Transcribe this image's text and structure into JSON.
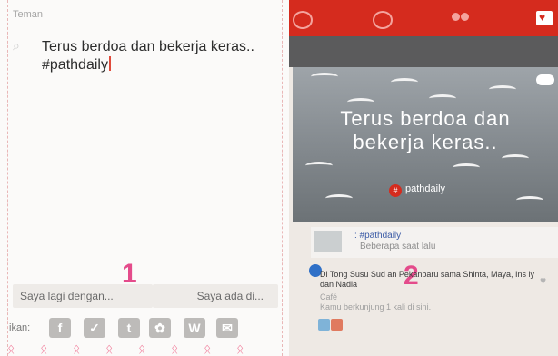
{
  "compose": {
    "section_label": "Teman",
    "text_line1": "Terus berdoa dan bekerja keras..",
    "text_line2": "#pathdaily",
    "with_placeholder": "Saya lagi dengan...",
    "at_placeholder": "Saya ada di...",
    "share_label": "ikan:",
    "share_icons": [
      "facebook-icon",
      "twitter-icon",
      "tumblr-icon",
      "flickr-icon",
      "wordpress-icon",
      "email-icon"
    ],
    "annotation_number": "1"
  },
  "feed": {
    "post_text_line1": "Terus berdoa dan",
    "post_text_line2": "bekerja keras..",
    "post_tag": "pathdaily",
    "post_meta_title": ": #pathdaily",
    "post_meta_time": "Beberapa saat lalu",
    "checkin_text": "Di Tong Susu Sud  an Pekanbaru sama Shinta, Maya, Ins  ly dan Nadia",
    "checkin_category": "Café",
    "checkin_visits": "Kamu berkunjung 1 kali di sini.",
    "annotation_number": "2"
  },
  "colors": {
    "topbar": "#d52b1e",
    "accent_pink": "#e44b8b"
  }
}
